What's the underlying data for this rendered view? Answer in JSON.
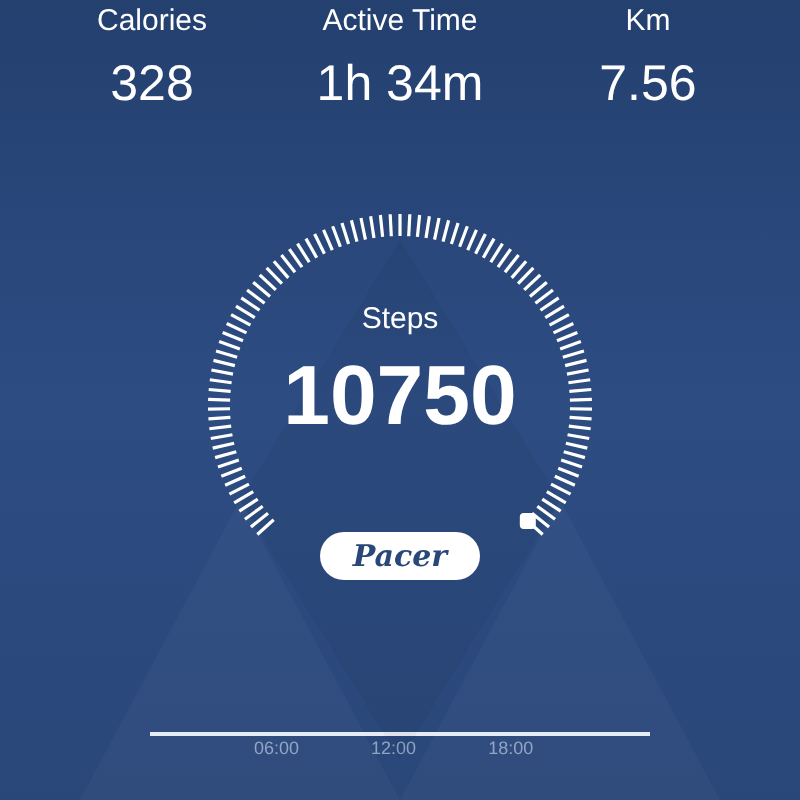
{
  "stats": [
    {
      "label": "Calories",
      "value": "328"
    },
    {
      "label": "Active Time",
      "value": "1h 34m"
    },
    {
      "label": "Km",
      "value": "7.56"
    }
  ],
  "gauge": {
    "label": "Steps",
    "value": "10750"
  },
  "brand": "Pacer",
  "timeline": {
    "ticks": [
      "06:00",
      "12:00",
      "18:00"
    ]
  }
}
